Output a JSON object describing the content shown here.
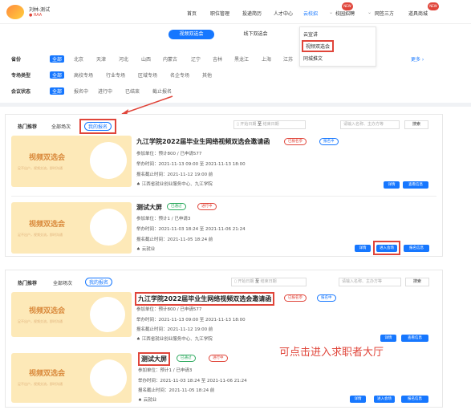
{
  "header": {
    "brand": "刘林-测试",
    "brand_sub": "● RAA",
    "nav": [
      "首页",
      "职位管理",
      "投递简历",
      "人才中心",
      "云校招",
      "校园招聘",
      "网签三方",
      "道具商城"
    ],
    "nav_active": "云校招",
    "new_badge": "NEW",
    "dropdown": [
      "云宣讲",
      "视频双选会",
      "同城推文"
    ]
  },
  "tabs": {
    "video": "视频双选会",
    "offline": "线下双选会"
  },
  "filters": {
    "province_label": "省份",
    "provinces": [
      "全部",
      "北京",
      "天津",
      "河北",
      "山西",
      "内蒙古",
      "辽宁",
      "吉林",
      "黑龙江",
      "上海",
      "江苏"
    ],
    "more": "更多 ›",
    "type_label": "专场类型",
    "types": [
      "全部",
      "高校专场",
      "行业专场",
      "区域专场",
      "名企专场",
      "其他"
    ],
    "status_label": "会议状态",
    "statuses": [
      "全部",
      "报名中",
      "进行中",
      "已结束",
      "截止报名"
    ]
  },
  "panel": {
    "tabs": [
      "热门推荐",
      "全部场次",
      "我的报名"
    ],
    "start_date": "开始日期",
    "to": "至",
    "end_date": "结束日期",
    "search_placeholder": "请输入名称、主办方等",
    "search_btn": "搜索"
  },
  "cards": [
    {
      "img_title": "视频双选会",
      "img_sub": "足不出户，视频交流，即时沟通",
      "title": "九江学院2022届毕业生网络视频双选会邀请函",
      "tags": [
        "已报名参",
        "报名中"
      ],
      "units": "参加单位：预计800 / 已申请577",
      "time": "举办时间：2021-11-13 09:00  至  2021-11-13 18:00",
      "deadline": "报名截止时间：2021-11-12 19:00 前",
      "org": "江西省就业创业服务中心、九江学院",
      "buttons": [
        "详情",
        "查看信息"
      ]
    },
    {
      "img_title": "视频双选会",
      "img_sub": "足不出户，视频交流，即时沟通",
      "title": "测试大屏",
      "tags": [
        "已通过",
        "进行中"
      ],
      "units": "参加单位：预计1 / 已申请3",
      "time": "举办时间：2021-11-03 18:24  至  2021-11-06 21:24",
      "deadline": "报名截止时间：2021-11-05 18:24 前",
      "org": "云就业",
      "buttons": [
        "详情",
        "进入会场",
        "报名信息"
      ]
    }
  ],
  "annotation": "可点击进入求职者大厅"
}
